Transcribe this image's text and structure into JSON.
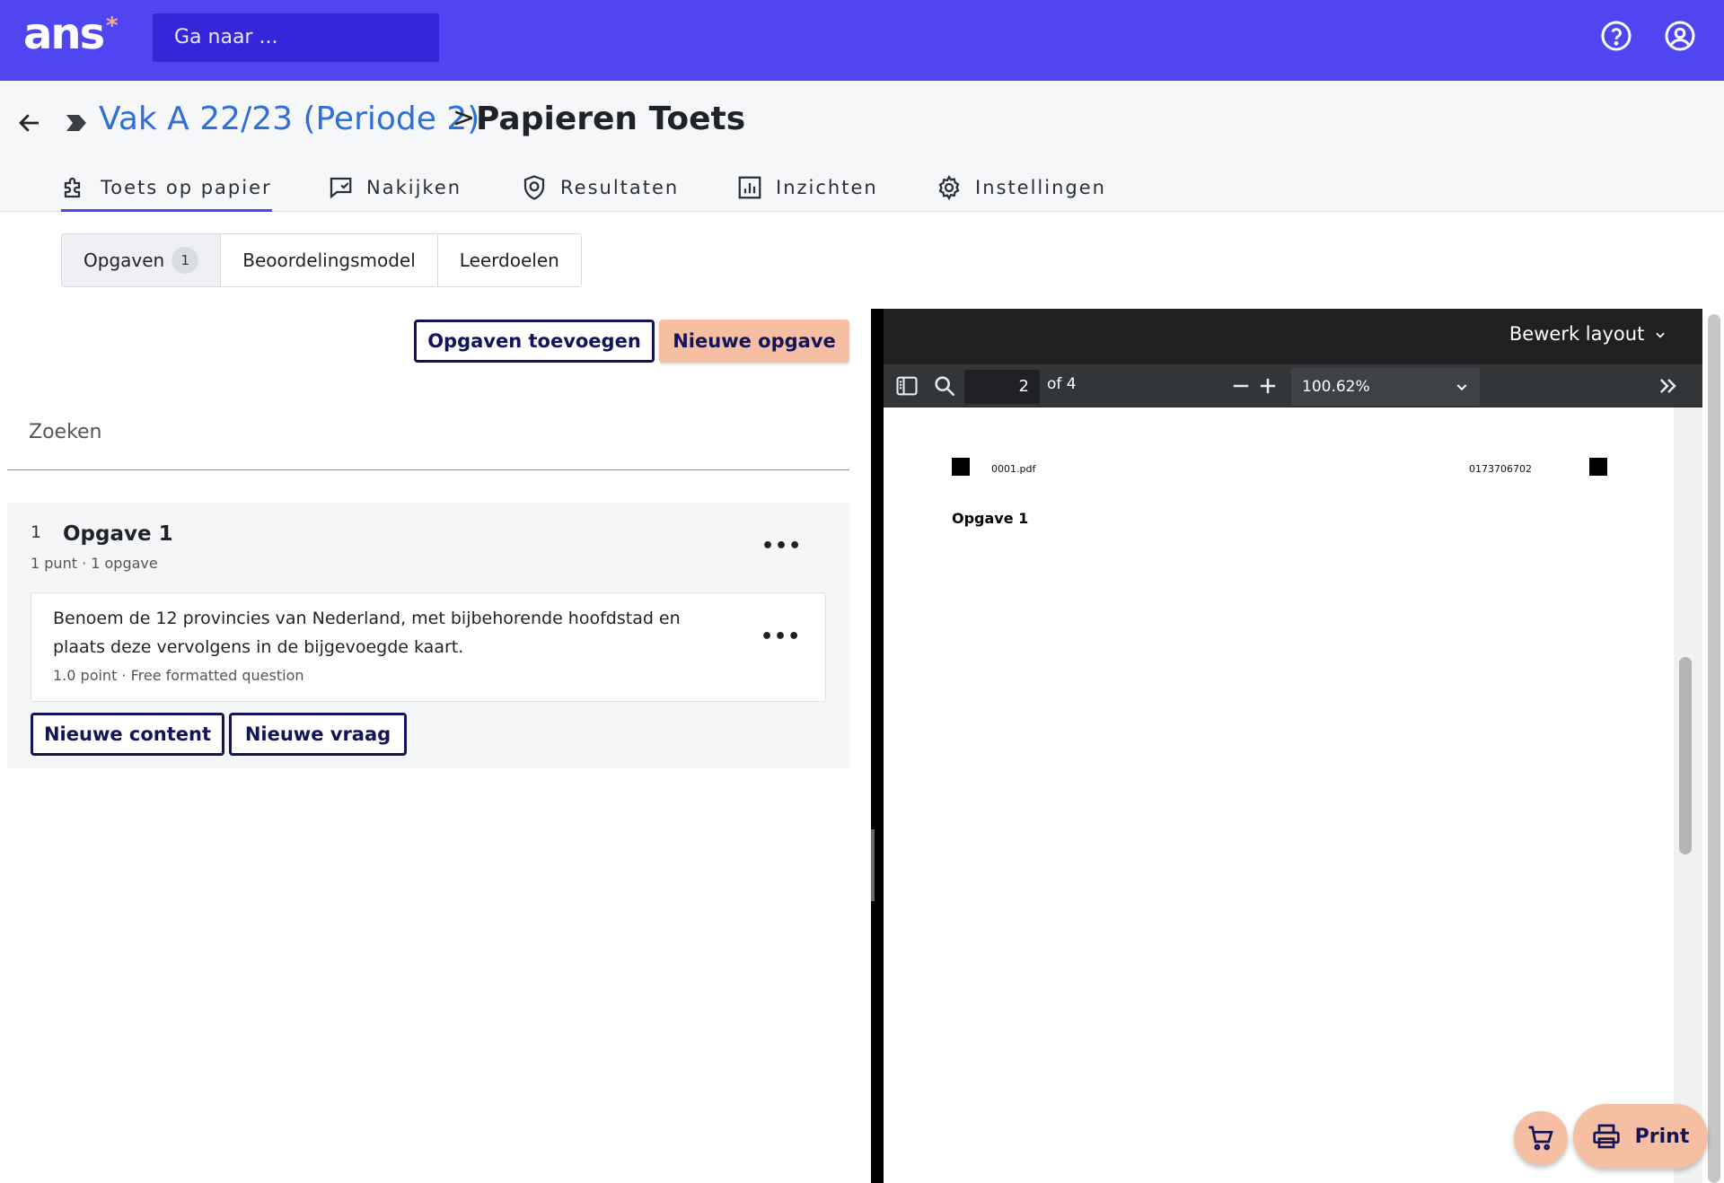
{
  "topbar": {
    "logo_text": "ans",
    "logo_star": "*",
    "search_placeholder": "Ga naar ...",
    "help_icon": "help-circle-icon",
    "user_icon": "user-circle-icon"
  },
  "breadcrumb": {
    "parent": "Vak A 22/23 (Periode 2)",
    "separator": ">",
    "current": "Papieren Toets"
  },
  "tabs": [
    {
      "label": "Toets op papier",
      "icon": "puzzle-icon",
      "active": true
    },
    {
      "label": "Nakijken",
      "icon": "chat-check-icon",
      "active": false
    },
    {
      "label": "Resultaten",
      "icon": "shield-icon",
      "active": false
    },
    {
      "label": "Inzichten",
      "icon": "bar-chart-icon",
      "active": false
    },
    {
      "label": "Instellingen",
      "icon": "gear-icon",
      "active": false
    }
  ],
  "subtabs": [
    {
      "label": "Opgaven",
      "badge": "1",
      "active": true
    },
    {
      "label": "Beoordelingsmodel"
    },
    {
      "label": "Leerdoelen"
    }
  ],
  "actions": {
    "add_exercises": "Opgaven toevoegen",
    "new_exercise": "Nieuwe opgave"
  },
  "search": {
    "placeholder": "Zoeken"
  },
  "exercise": {
    "number": "1",
    "title": "Opgave 1",
    "meta": "1 punt · 1 opgave",
    "question": {
      "text": "Benoem de 12 provincies van Nederland, met bijbehorende hoofdstad en plaats deze vervolgens in de bijgevoegde kaart.",
      "meta": "1.0 point · Free formatted question"
    },
    "new_content": "Nieuwe content",
    "new_question": "Nieuwe vraag",
    "more": "•••"
  },
  "viewer": {
    "edit_layout": "Bewerk layout",
    "page_current": "2",
    "page_total": "of 4",
    "zoom": "100.62%",
    "pdf": {
      "filename": "0001.pdf",
      "code": "0173706702",
      "heading": "Opgave 1"
    }
  },
  "fab": {
    "cart_icon": "cart-icon",
    "print_label": "Print",
    "print_icon": "printer-icon"
  },
  "colors": {
    "brand": "#4f46f2",
    "brand_dark": "#3626d9",
    "accent_peach": "#f6bfa4",
    "link_blue": "#2f6fd6",
    "navy": "#12145a"
  }
}
